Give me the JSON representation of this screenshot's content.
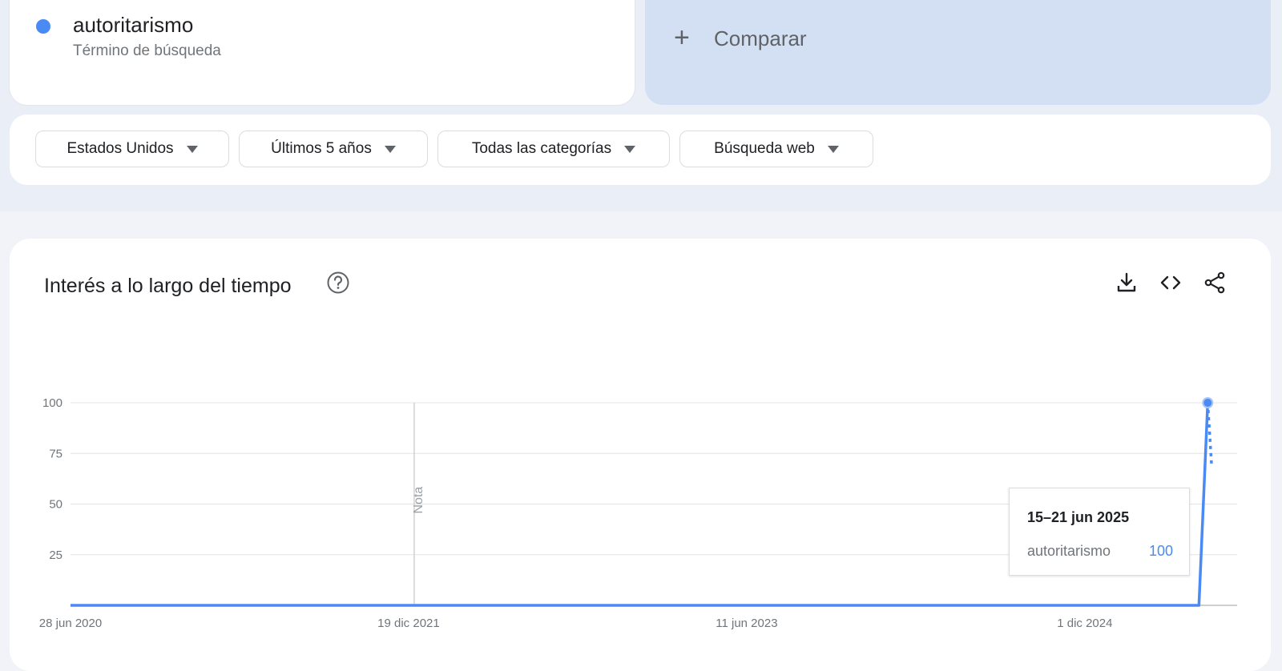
{
  "colors": {
    "series": "#4a8af4",
    "compare_bg": "#d3e0f4",
    "grid": "#e3e3e3"
  },
  "term_card": {
    "name": "autoritarismo",
    "subtitle": "Término de búsqueda"
  },
  "compare": {
    "label": "Comparar"
  },
  "filters": [
    {
      "label": "Estados Unidos"
    },
    {
      "label": "Últimos 5 años"
    },
    {
      "label": "Todas las categorías"
    },
    {
      "label": "Búsqueda web"
    }
  ],
  "chart_section": {
    "title": "Interés a lo largo del tiempo",
    "icons": [
      "help-icon",
      "download-icon",
      "embed-code-icon",
      "share-icon"
    ]
  },
  "chart_data": {
    "type": "line",
    "xlabel": "",
    "ylabel": "",
    "x_range": [
      "2020-06-28",
      "2025-06-21"
    ],
    "ylim": [
      0,
      100
    ],
    "y_ticks": [
      25,
      50,
      75,
      100
    ],
    "x_tick_labels": [
      "28 jun 2020",
      "19 dic 2021",
      "11 jun 2023",
      "1 dic 2024"
    ],
    "x_tick_dates": [
      "2020-06-28",
      "2021-12-19",
      "2023-06-11",
      "2024-12-01"
    ],
    "grid": true,
    "series": [
      {
        "name": "autoritarismo",
        "points": [
          {
            "x": "2020-06-28",
            "y": 0
          },
          {
            "x": "2025-06-01",
            "y": 0
          },
          {
            "x": "2025-06-15",
            "y": 100
          }
        ],
        "partial_points": [
          {
            "x": "2025-06-15",
            "y": 100
          },
          {
            "x": "2025-06-21",
            "y": 70
          }
        ]
      }
    ],
    "annotations": [
      {
        "x": "2021-12-19",
        "label": "Nota"
      }
    ],
    "tooltip": {
      "date": "15–21 jun 2025",
      "term": "autoritarismo",
      "value": "100"
    }
  }
}
